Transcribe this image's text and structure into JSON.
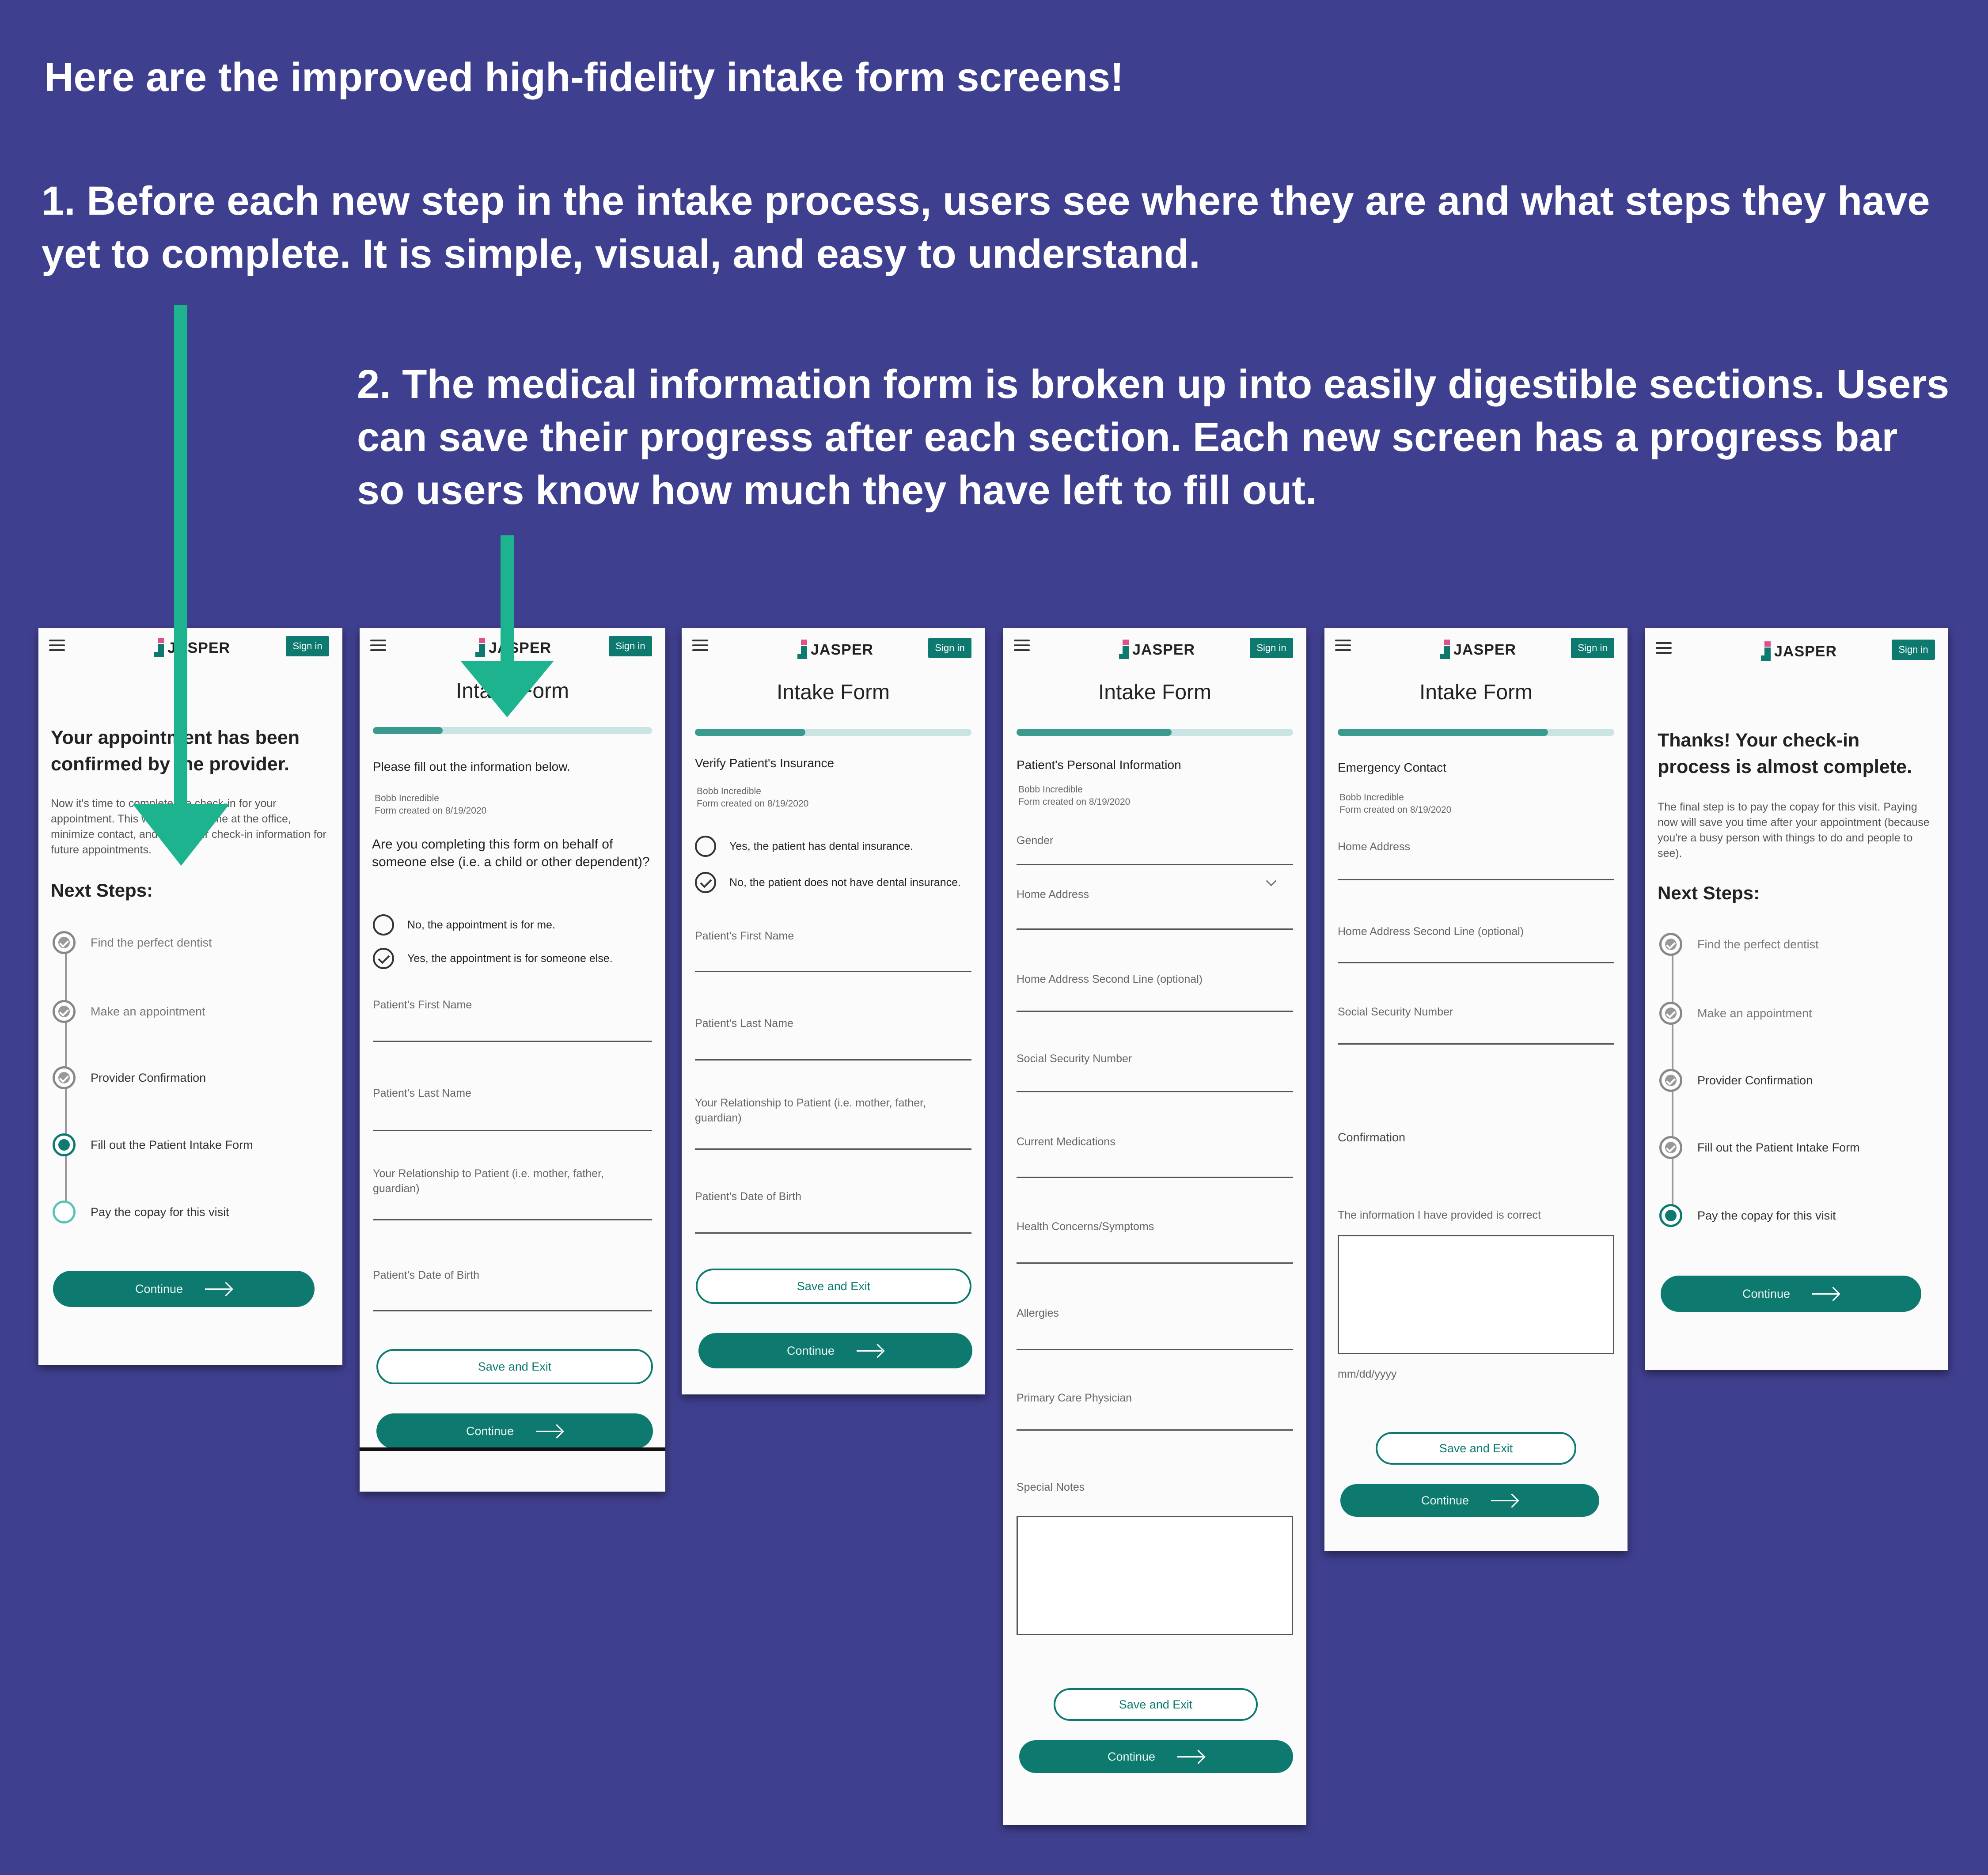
{
  "headline": "Here are the improved high-fidelity intake form screens!",
  "point1": "1.  Before each new step in the intake process, users see where they are and what steps they have yet to complete.  It is simple, visual, and easy to understand.",
  "point2": "2.  The medical information form is broken up into easily digestible sections.  Users can save their progress after each section.  Each new screen has a progress bar so users know how much they have left to fill out.",
  "app": {
    "logo": "JASPER",
    "signin": "Sign in",
    "form_title": "Intake Form",
    "continue": "Continue",
    "save_exit": "Save and Exit"
  },
  "colors": {
    "background": "#3f3f8f",
    "teal": "#0e7a6f",
    "progress_track": "#c9e4e2",
    "progress_fill": "#3a9a8e",
    "arrow_green": "#1cb38e",
    "logo_pink": "#e0508a"
  },
  "steps": [
    "Find the perfect dentist",
    "Make an appointment",
    "Provider Confirmation",
    "Fill out the Patient Intake Form",
    "Pay the copay for this visit"
  ],
  "next_steps": "Next Steps:",
  "screen1": {
    "heading": "Your appointment has been confirmed by the provider.",
    "body": "Now it's time to complete the check-in for your appointment.  This will save you time at the office, minimize contact, and save your check-in information for future appointments.",
    "current_step": 4
  },
  "meta": {
    "patient": "Bobb Incredible",
    "created": "Form created on 8/19/2020"
  },
  "screen2": {
    "progress": 0.25,
    "section": "Please fill out the information below.",
    "question": "Are you completing this form on behalf of someone else (i.e. a child or other dependent)?",
    "options": [
      "No, the appointment is for me.",
      "Yes, the appointment is for someone else."
    ],
    "selected": 1,
    "fields": [
      "Patient's First Name",
      "Patient's Last Name",
      "Your Relationship to Patient (i.e. mother, father, guardian)",
      "Patient's Date of Birth"
    ]
  },
  "screen3": {
    "progress": 0.4,
    "section": "Verify Patient's Insurance",
    "options": [
      "Yes, the patient has dental insurance.",
      "No, the patient does not have dental insurance."
    ],
    "selected": 1,
    "fields": [
      "Patient's First Name",
      "Patient's Last Name",
      "Your Relationship to Patient (i.e. mother, father, guardian)",
      "Patient's Date of Birth"
    ]
  },
  "screen4": {
    "progress": 0.56,
    "section": "Patient's Personal Information",
    "fields": [
      "Gender",
      "Home Address",
      "Home Address Second Line (optional)",
      "Social Security Number",
      "Current Medications",
      "Health Concerns/Symptoms",
      "Allergies",
      "Primary Care Physician",
      "Special Notes"
    ]
  },
  "screen5": {
    "progress": 0.76,
    "section": "Emergency Contact",
    "fields": [
      "Home Address",
      "Home Address Second Line (optional)",
      "Social Security Number"
    ],
    "confirmation": "Confirmation",
    "confirm_text": "The information I have provided is correct",
    "date_placeholder": "mm/dd/yyyy"
  },
  "screen6": {
    "heading": "Thanks!  Your check-in process is almost complete.",
    "body": "The final step is to pay the copay for this visit. Paying now will save you time after your appointment (because you're a busy person with things to do and people to see).",
    "current_step": 5
  }
}
